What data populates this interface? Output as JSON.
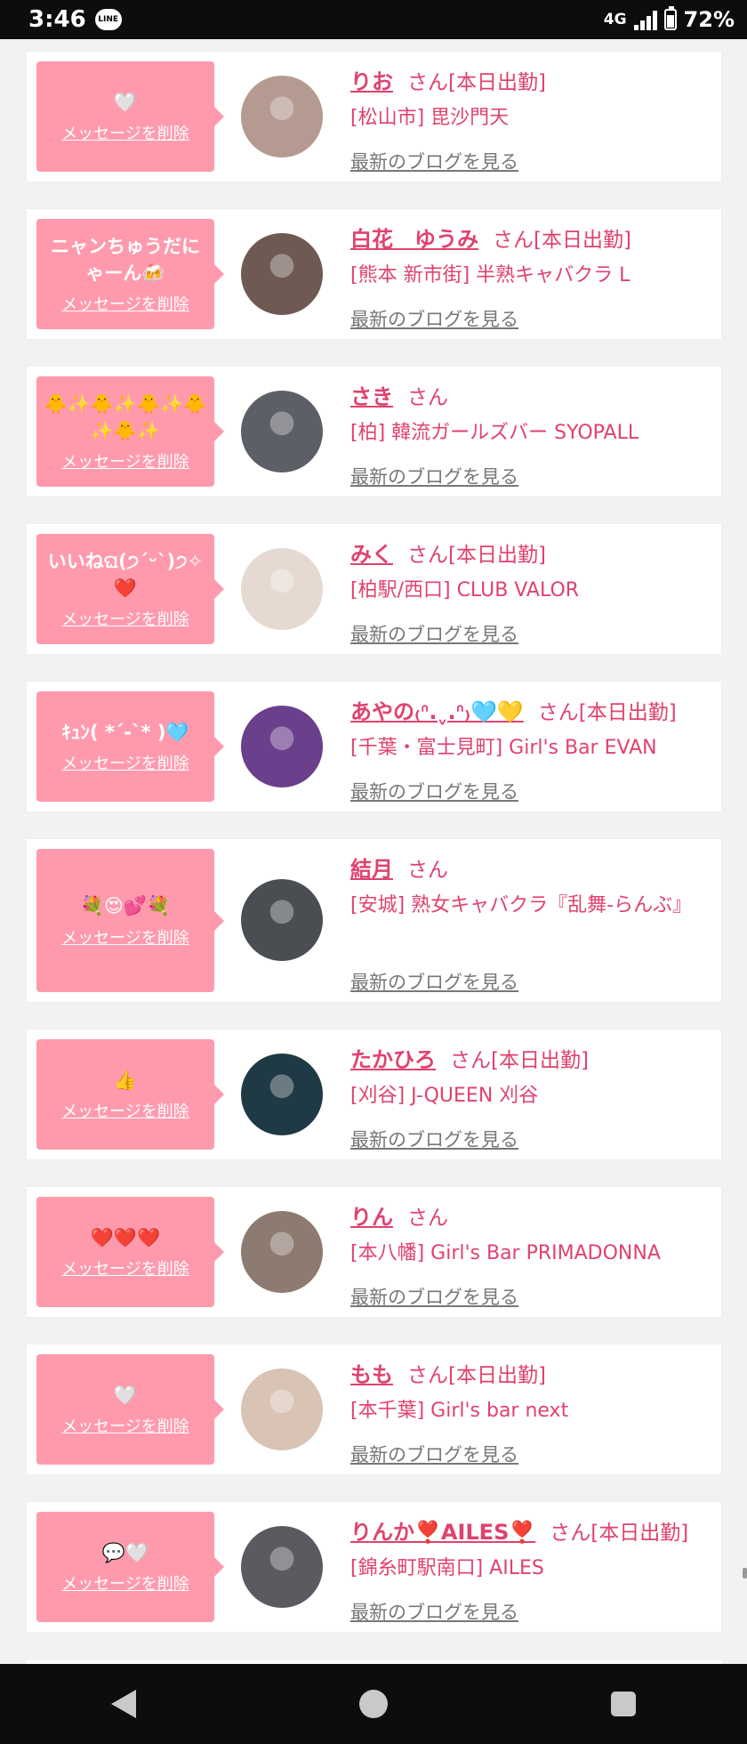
{
  "statusbar": {
    "time": "3:46",
    "app_badge": "LINE",
    "network": "4G",
    "battery": "72%",
    "battery_level": 0.72
  },
  "common": {
    "delete_label": "メッセージを削除",
    "blog_label": "最新のブログを見る"
  },
  "items": [
    {
      "message": "🤍",
      "name": "りお",
      "suffix": "さん[本日出勤]",
      "shop": "[松山市] 毘沙門天",
      "avatar_color": "#b49a90"
    },
    {
      "message": "ニャンちゅうだにゃーん🍻",
      "name": "白花　ゆうみ",
      "suffix": "さん[本日出勤]",
      "shop": "[熊本 新市街] 半熟キャバクラ L",
      "avatar_color": "#6e5a52"
    },
    {
      "message": "🐥✨🐥✨🐥✨🐥✨🐥✨",
      "name": "さき",
      "suffix": "さん",
      "shop": "[柏] 韓流ガールズバー SYOPALL",
      "avatar_color": "#5d5f66"
    },
    {
      "message": "いいねଘ(੭ˊᵕˋ)੭✧❤️",
      "name": "みく",
      "suffix": "さん[本日出勤]",
      "shop": "[柏駅/西口] CLUB VALOR",
      "avatar_color": "#e6d9d2"
    },
    {
      "message": "ｷｭﾝ( *´-`* )🩵",
      "name": "あやの₍ᐢ.ˬ.ᐢ₎🩵💛",
      "suffix": "さん[本日出勤]",
      "shop": "[千葉・富士見町] Girl's Bar EVAN",
      "avatar_color": "#6a3f8c"
    },
    {
      "message": "💐😍💕💐",
      "name": "結月",
      "suffix": "さん",
      "shop": "[安城] 熟女キャバクラ『乱舞-らんぶ』",
      "avatar_color": "#4a4e52"
    },
    {
      "message": "👍",
      "name": "たかひろ",
      "suffix": "さん[本日出勤]",
      "shop": "[刈谷] J-QUEEN 刈谷",
      "avatar_color": "#1f3a44"
    },
    {
      "message": "❤️❤️❤️",
      "name": "りん",
      "suffix": "さん",
      "shop": "[本八幡] Girl's Bar PRIMADONNA",
      "avatar_color": "#8d7a70"
    },
    {
      "message": "🤍",
      "name": "もも",
      "suffix": "さん[本日出勤]",
      "shop": "[本千葉] Girl's bar next",
      "avatar_color": "#d9c3b5"
    },
    {
      "message": "💬🤍",
      "name": "りんか❣️AILES❣️",
      "suffix": "さん[本日出勤]",
      "shop": "[錦糸町駅南口] AILES",
      "avatar_color": "#5a5a60"
    }
  ]
}
